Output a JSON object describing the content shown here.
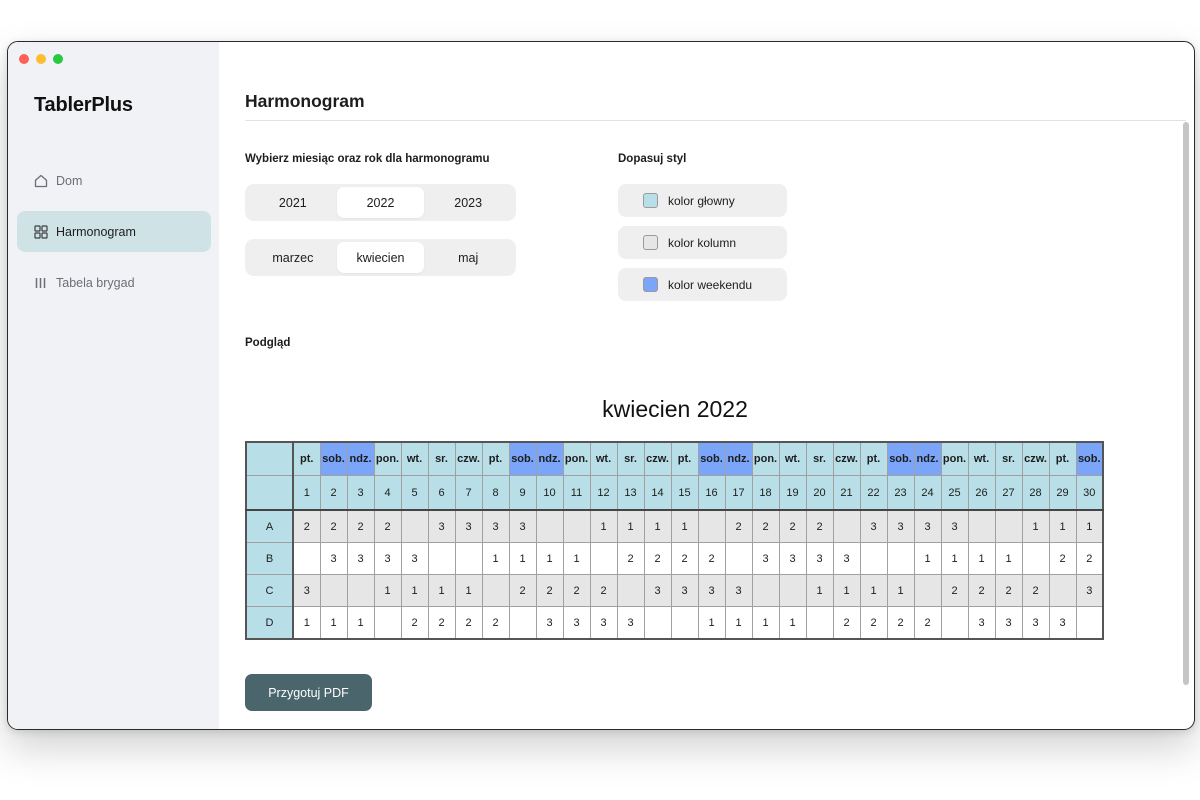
{
  "app": {
    "title": "TablerPlus"
  },
  "sidebar": {
    "items": [
      {
        "label": "Dom",
        "icon": "home-icon"
      },
      {
        "label": "Harmonogram",
        "icon": "grid-icon"
      },
      {
        "label": "Tabela brygad",
        "icon": "columns-icon"
      }
    ]
  },
  "page": {
    "title": "Harmonogram",
    "month_year_label": "Wybierz miesiąc oraz rok dla harmonogramu",
    "style_label": "Dopasuj styl",
    "preview_label": "Podgląd",
    "pdf_button": "Przygotuj PDF"
  },
  "years": {
    "options": [
      "2021",
      "2022",
      "2023"
    ],
    "selected": "2022"
  },
  "months": {
    "options": [
      "marzec",
      "kwiecien",
      "maj"
    ],
    "selected": "kwiecien"
  },
  "style_options": [
    {
      "label": "kolor głowny",
      "color": "#b8dfe7"
    },
    {
      "label": "kolor kolumn",
      "color": "#e6e6e6"
    },
    {
      "label": "kolor weekendu",
      "color": "#7aa5f8"
    }
  ],
  "schedule": {
    "title": "kwiecien 2022",
    "days": [
      "pt.",
      "sob.",
      "ndz.",
      "pon.",
      "wt.",
      "sr.",
      "czw.",
      "pt.",
      "sob.",
      "ndz.",
      "pon.",
      "wt.",
      "sr.",
      "czw.",
      "pt.",
      "sob.",
      "ndz.",
      "pon.",
      "wt.",
      "sr.",
      "czw.",
      "pt.",
      "sob.",
      "ndz.",
      "pon.",
      "wt.",
      "sr.",
      "czw.",
      "pt.",
      "sob."
    ],
    "dates": [
      "1",
      "2",
      "3",
      "4",
      "5",
      "6",
      "7",
      "8",
      "9",
      "10",
      "11",
      "12",
      "13",
      "14",
      "15",
      "16",
      "17",
      "18",
      "19",
      "20",
      "21",
      "22",
      "23",
      "24",
      "25",
      "26",
      "27",
      "28",
      "29",
      "30"
    ],
    "rows": [
      {
        "label": "A",
        "cells": [
          "2",
          "2",
          "2",
          "2",
          "",
          "3",
          "3",
          "3",
          "3",
          "",
          "",
          "1",
          "1",
          "1",
          "1",
          "",
          "2",
          "2",
          "2",
          "2",
          "",
          "3",
          "3",
          "3",
          "3",
          "",
          "",
          "1",
          "1",
          "1"
        ]
      },
      {
        "label": "B",
        "cells": [
          "",
          "3",
          "3",
          "3",
          "3",
          "",
          "",
          "1",
          "1",
          "1",
          "1",
          "",
          "2",
          "2",
          "2",
          "2",
          "",
          "3",
          "3",
          "3",
          "3",
          "",
          "",
          "1",
          "1",
          "1",
          "1",
          "",
          "2",
          "2"
        ]
      },
      {
        "label": "C",
        "cells": [
          "3",
          "",
          "",
          "1",
          "1",
          "1",
          "1",
          "",
          "2",
          "2",
          "2",
          "2",
          "",
          "3",
          "3",
          "3",
          "3",
          "",
          "",
          "1",
          "1",
          "1",
          "1",
          "",
          "2",
          "2",
          "2",
          "2",
          "",
          "3"
        ]
      },
      {
        "label": "D",
        "cells": [
          "1",
          "1",
          "1",
          "",
          "2",
          "2",
          "2",
          "2",
          "",
          "3",
          "3",
          "3",
          "3",
          "",
          "",
          "1",
          "1",
          "1",
          "1",
          "",
          "2",
          "2",
          "2",
          "2",
          "",
          "3",
          "3",
          "3",
          "3",
          ""
        ]
      }
    ]
  }
}
